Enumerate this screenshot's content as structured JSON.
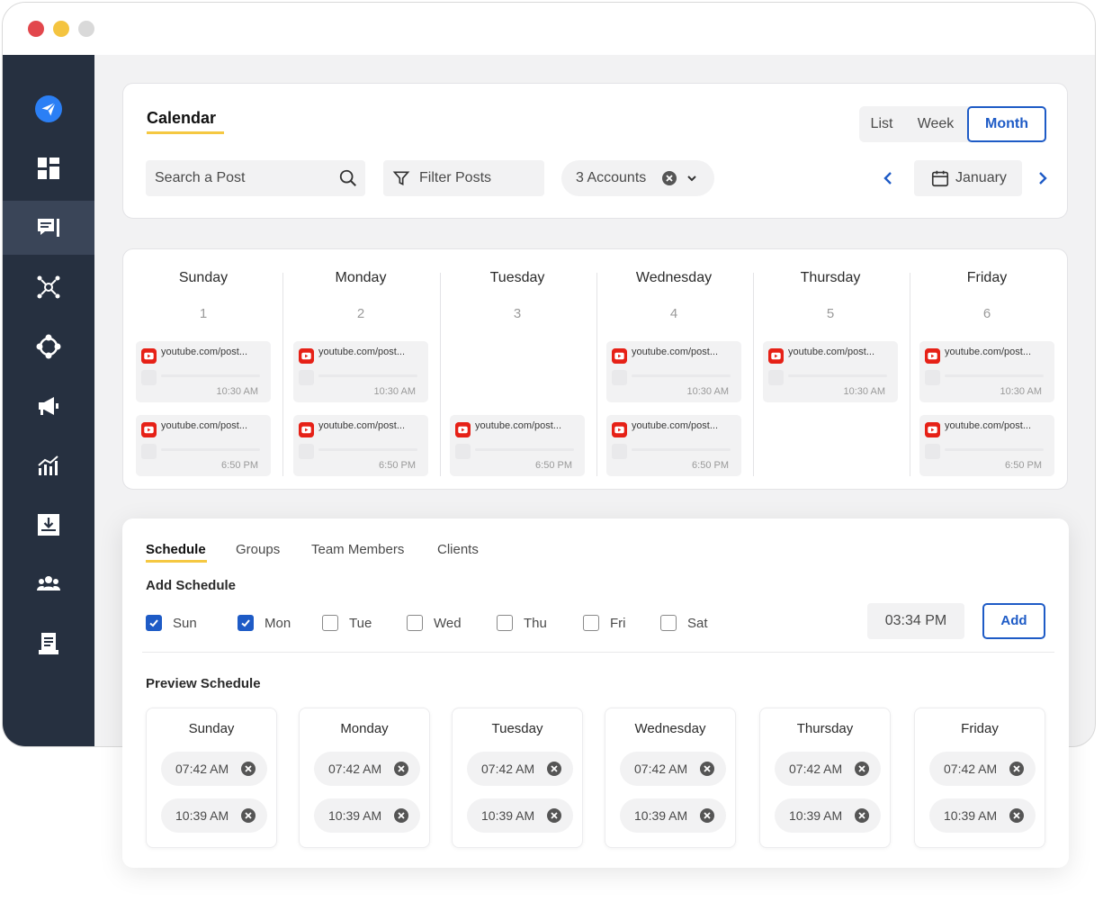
{
  "calendar": {
    "title": "Calendar",
    "view_tabs": [
      "List",
      "Week",
      "Month"
    ],
    "active_view": "Month",
    "search": {
      "placeholder": "Search a Post"
    },
    "filter_label": "Filter Posts",
    "accounts_label": "3 Accounts",
    "month": "January",
    "days": [
      {
        "name": "Sunday",
        "num": "1",
        "posts": [
          {
            "url": "youtube.com/post...",
            "time": "10:30 AM"
          },
          {
            "url": "youtube.com/post...",
            "time": "6:50 PM"
          }
        ]
      },
      {
        "name": "Monday",
        "num": "2",
        "posts": [
          {
            "url": "youtube.com/post...",
            "time": "10:30 AM"
          },
          {
            "url": "youtube.com/post...",
            "time": "6:50 PM"
          }
        ]
      },
      {
        "name": "Tuesday",
        "num": "3",
        "posts": [
          {
            "url": "youtube.com/post...",
            "time": "6:50 PM"
          }
        ]
      },
      {
        "name": "Wednesday",
        "num": "4",
        "posts": [
          {
            "url": "youtube.com/post...",
            "time": "10:30 AM"
          },
          {
            "url": "youtube.com/post...",
            "time": "6:50 PM"
          }
        ]
      },
      {
        "name": "Thursday",
        "num": "5",
        "posts": [
          {
            "url": "youtube.com/post...",
            "time": "10:30 AM"
          }
        ]
      },
      {
        "name": "Friday",
        "num": "6",
        "posts": [
          {
            "url": "youtube.com/post...",
            "time": "10:30 AM"
          },
          {
            "url": "youtube.com/post...",
            "time": "6:50 PM"
          }
        ]
      }
    ]
  },
  "schedule": {
    "tabs": [
      "Schedule",
      "Groups",
      "Team Members",
      "Clients"
    ],
    "active_tab": "Schedule",
    "add_title": "Add Schedule",
    "weekdays": [
      {
        "label": "Sun",
        "checked": true
      },
      {
        "label": "Mon",
        "checked": true
      },
      {
        "label": "Tue",
        "checked": false
      },
      {
        "label": "Wed",
        "checked": false
      },
      {
        "label": "Thu",
        "checked": false
      },
      {
        "label": "Fri",
        "checked": false
      },
      {
        "label": "Sat",
        "checked": false
      }
    ],
    "time_value": "03:34 PM",
    "add_label": "Add",
    "preview_title": "Preview Schedule",
    "preview": [
      {
        "day": "Sunday",
        "times": [
          "07:42 AM",
          "10:39 AM"
        ]
      },
      {
        "day": "Monday",
        "times": [
          "07:42 AM",
          "10:39 AM"
        ]
      },
      {
        "day": "Tuesday",
        "times": [
          "07:42 AM",
          "10:39 AM"
        ]
      },
      {
        "day": "Wednesday",
        "times": [
          "07:42 AM",
          "10:39 AM"
        ]
      },
      {
        "day": "Thursday",
        "times": [
          "07:42 AM",
          "10:39 AM"
        ]
      },
      {
        "day": "Friday",
        "times": [
          "07:42 AM",
          "10:39 AM"
        ]
      }
    ]
  },
  "sidebar": {
    "icons": [
      "send-icon",
      "dashboard-icon",
      "posts-icon",
      "network-icon",
      "integrations-icon",
      "campaign-icon",
      "analytics-icon",
      "download-icon",
      "team-icon",
      "reports-icon"
    ],
    "active_index": 2
  },
  "colors": {
    "accent": "#1e5bc6",
    "sidebar": "#263040",
    "sidebar_active": "#3a4558",
    "underline": "#f5c842",
    "youtube": "#e62117",
    "brand_icon": "#2b7ff5"
  }
}
